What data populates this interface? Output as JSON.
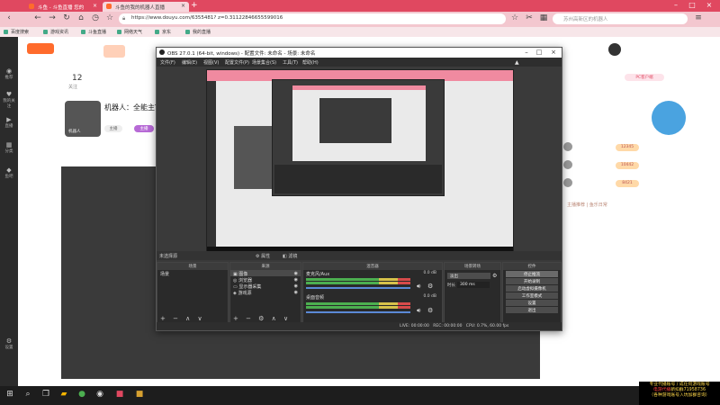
{
  "browser": {
    "tabs": [
      {
        "label": "斗鱼 - 斗鱼直播 您的"
      },
      {
        "label": "斗鱼的我的机器人直播"
      }
    ],
    "url": "https://www.douyu.com/6355481? z=0.31122846655599016",
    "search_placeholder": "苏州高新区的机器人",
    "bookmarks": [
      "百度搜索",
      "游戏资讯",
      "斗鱼直播",
      "网络天气",
      "京东",
      "我的直播"
    ]
  },
  "page": {
    "left_nav": [
      "推荐",
      "我的关注",
      "直播",
      "分类",
      "鱼吧",
      "设置"
    ],
    "stats": [
      {
        "value": "12",
        "label": "关注"
      }
    ],
    "streamer_title": "机器人：全能主T",
    "streamer_name": "机器人",
    "badges": [
      "主播",
      "主播"
    ],
    "right_ranks": [
      "12345",
      "10442",
      "8421"
    ],
    "right_button": "PC客户端",
    "footer_text": "主播推荐 | 鱼乐日常"
  },
  "obs": {
    "title": "OBS 27.0.1 (64-bit, windows) - 配置文件: 未命名 - 场景: 未命名",
    "menu": [
      "文件(F)",
      "编辑(E)",
      "视图(V)",
      "配置文件(P)",
      "场景集合(S)",
      "工具(T)",
      "帮助(H)"
    ],
    "scene_bar": {
      "label": "未选择源",
      "props": "属性",
      "filters": "滤镜"
    },
    "docks": {
      "scenes": {
        "header": "场景",
        "items": [
          "场景"
        ]
      },
      "sources": {
        "header": "来源",
        "items": [
          "图像",
          "浏览器",
          "显示器采集",
          "游戏源"
        ]
      },
      "mixer": {
        "header": "混音器",
        "channels": [
          {
            "name": "麦克风/Aux",
            "db": "0.0 dB"
          },
          {
            "name": "桌面音频",
            "db": "0.0 dB"
          }
        ]
      },
      "transitions": {
        "header": "场景转场",
        "type": "淡出",
        "duration_label": "时长",
        "duration": "300 ms"
      },
      "controls": {
        "header": "控件",
        "buttons": [
          "停止推流",
          "开始录制",
          "启动虚拟摄像机",
          "工作室模式",
          "设置",
          "退出"
        ]
      }
    },
    "status": {
      "live": "LIVE: 00:00:00",
      "rec": "REC: 00:00:00",
      "cpu": "CPU: 0.7%, 60.00 fps"
    }
  },
  "taskbar": {
    "icons": [
      "windows-icon",
      "search-icon",
      "task-view-icon",
      "explorer-icon",
      "chrome-icon",
      "obs-icon",
      "app-icon",
      "app2-icon"
    ]
  },
  "notice": {
    "line1": "专业代播账号 / 成任何游戏账号",
    "line2_red": "电游代播",
    "line2": "新扣群71958736",
    "line3": "（各种游戏账号入坑加群咨询）"
  },
  "colors": {
    "brand": "#e04860",
    "accent": "#ff6b2c"
  }
}
